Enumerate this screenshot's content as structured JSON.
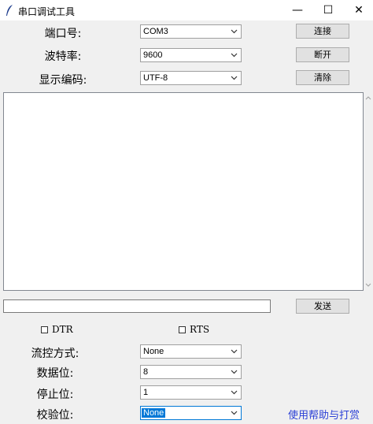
{
  "window": {
    "title": "串口调试工具",
    "minimize": "—",
    "maximize": "☐",
    "close": "✕"
  },
  "top": {
    "port_label": "端口号:",
    "port_value": "COM3",
    "baud_label": "波特率:",
    "baud_value": "9600",
    "encoding_label": "显示编码:",
    "encoding_value": "UTF-8",
    "connect_button": "连接",
    "disconnect_button": "断开",
    "clear_button": "清除"
  },
  "output": {
    "text": "",
    "send_input": "",
    "send_button": "发送"
  },
  "options": {
    "dtr_label": "DTR",
    "rts_label": "RTS",
    "flow_label": "流控方式:",
    "flow_value": "None",
    "databits_label": "数据位:",
    "databits_value": "8",
    "stopbits_label": "停止位:",
    "stopbits_value": "1",
    "parity_label": "校验位:",
    "parity_value": "None",
    "help_link": "使用帮助与打赏"
  },
  "colors": {
    "link": "#2a3fd6",
    "focus": "#0078d7"
  }
}
